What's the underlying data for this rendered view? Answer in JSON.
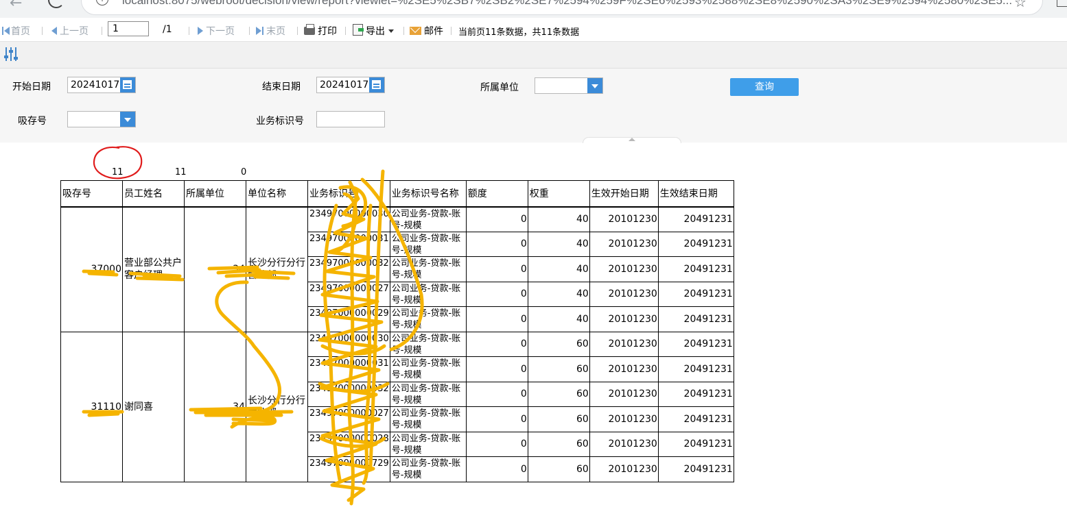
{
  "browser": {
    "url": "localhost:8075/webroot/decision/view/report?viewlet=%2SE5%2SB7%2SB2%2SE7%2594%259F%2SE6%2593%2588%2SE8%2590%2SA3%2SE9%2594%2580%2SE5..."
  },
  "toolbar": {
    "first": "首页",
    "prev": "上一页",
    "page_value": "1",
    "page_total": "/1",
    "next": "下一页",
    "last": "末页",
    "print": "打印",
    "export": "导出",
    "mail": "邮件",
    "status": "当前页11条数据，共11条数据"
  },
  "params": {
    "start_label": "开始日期",
    "start_value": "20241017",
    "end_label": "结束日期",
    "end_value": "20241017",
    "unit_label": "所属单位",
    "store_label": "吸存号",
    "biz_label": "业务标识号",
    "query_label": "查询"
  },
  "counts": [
    "11",
    "11",
    "0"
  ],
  "table": {
    "headers": [
      "吸存号",
      "员工姓名",
      "所属单位",
      "单位名称",
      "业务标识号",
      "业务标识号名称",
      "额度",
      "权重",
      "生效开始日期",
      "生效结束日期"
    ],
    "groups": [
      {
        "store": "37000",
        "employee": "营业部公共户客户经理",
        "unit": "34",
        "unit_name": "长沙分行分行营业部",
        "rows": [
          {
            "biz": "23497000000030",
            "biz_name": "公司业务-贷款-账号-规模",
            "amount": "0",
            "weight": "40",
            "start": "20101230",
            "end": "20491231"
          },
          {
            "biz": "23497000000031",
            "biz_name": "公司业务-贷款-账号-规模",
            "amount": "0",
            "weight": "40",
            "start": "20101230",
            "end": "20491231"
          },
          {
            "biz": "23497000000032",
            "biz_name": "公司业务-贷款-账号-规模",
            "amount": "0",
            "weight": "40",
            "start": "20101230",
            "end": "20491231"
          },
          {
            "biz": "23497000000027",
            "biz_name": "公司业务-贷款-账号-规模",
            "amount": "0",
            "weight": "40",
            "start": "20101230",
            "end": "20491231"
          },
          {
            "biz": "23497000000029",
            "biz_name": "公司业务-贷款-账号-规模",
            "amount": "0",
            "weight": "40",
            "start": "20101230",
            "end": "20491231"
          }
        ]
      },
      {
        "store": "31110",
        "employee": "谢同喜",
        "unit": "34",
        "unit_name": "长沙分行分行营业部",
        "rows": [
          {
            "biz": "23497000000030",
            "biz_name": "公司业务-贷款-账号-规模",
            "amount": "0",
            "weight": "60",
            "start": "20101230",
            "end": "20491231"
          },
          {
            "biz": "23497000000031",
            "biz_name": "公司业务-贷款-账号-规模",
            "amount": "0",
            "weight": "60",
            "start": "20101230",
            "end": "20491231"
          },
          {
            "biz": "23497000000032",
            "biz_name": "公司业务-贷款-账号-规模",
            "amount": "0",
            "weight": "60",
            "start": "20101230",
            "end": "20491231"
          },
          {
            "biz": "23497000000027",
            "biz_name": "公司业务-贷款-账号-规模",
            "amount": "0",
            "weight": "60",
            "start": "20101230",
            "end": "20491231"
          },
          {
            "biz": "23497000000028",
            "biz_name": "公司业务-贷款-账号-规模",
            "amount": "0",
            "weight": "60",
            "start": "20101230",
            "end": "20491231"
          },
          {
            "biz": "23497000000729",
            "biz_name": "公司业务-贷款-账号-规模",
            "amount": "0",
            "weight": "60",
            "start": "20101230",
            "end": "20491231"
          }
        ]
      }
    ]
  },
  "colors": {
    "accent": "#3b8bd8",
    "query_button": "#3f9ee9",
    "scribble": "#f5b400",
    "annotation_circle": "#e01b1b"
  }
}
